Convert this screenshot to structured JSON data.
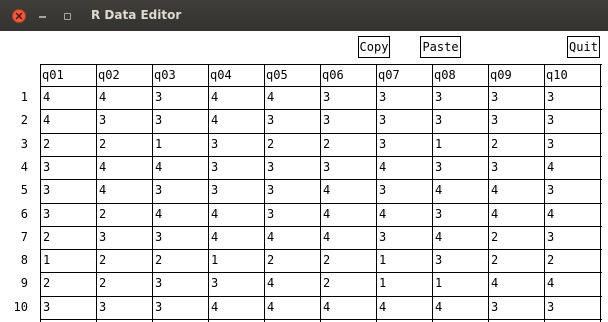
{
  "window": {
    "title": "R Data Editor"
  },
  "toolbar": {
    "copy_label": "Copy",
    "paste_label": "Paste",
    "quit_label": "Quit"
  },
  "table": {
    "columns": [
      "q01",
      "q02",
      "q03",
      "q04",
      "q05",
      "q06",
      "q07",
      "q08",
      "q09",
      "q10"
    ],
    "row_labels": [
      "1",
      "2",
      "3",
      "4",
      "5",
      "6",
      "7",
      "8",
      "9",
      "10"
    ],
    "rows": [
      [
        "4",
        "4",
        "3",
        "4",
        "4",
        "3",
        "3",
        "3",
        "3",
        "3"
      ],
      [
        "4",
        "3",
        "3",
        "4",
        "3",
        "3",
        "3",
        "3",
        "3",
        "3"
      ],
      [
        "2",
        "2",
        "1",
        "3",
        "2",
        "2",
        "3",
        "1",
        "2",
        "3"
      ],
      [
        "3",
        "4",
        "4",
        "3",
        "3",
        "3",
        "4",
        "3",
        "3",
        "4"
      ],
      [
        "3",
        "4",
        "3",
        "3",
        "3",
        "4",
        "3",
        "4",
        "4",
        "3"
      ],
      [
        "3",
        "2",
        "4",
        "4",
        "3",
        "4",
        "4",
        "3",
        "4",
        "4"
      ],
      [
        "2",
        "3",
        "3",
        "4",
        "4",
        "4",
        "3",
        "4",
        "2",
        "3"
      ],
      [
        "1",
        "2",
        "2",
        "1",
        "2",
        "2",
        "1",
        "3",
        "2",
        "2"
      ],
      [
        "2",
        "2",
        "3",
        "3",
        "4",
        "2",
        "1",
        "1",
        "4",
        "4"
      ],
      [
        "3",
        "3",
        "3",
        "4",
        "4",
        "4",
        "4",
        "4",
        "3",
        "3"
      ]
    ]
  },
  "colors": {
    "titlebar": "#3c3b37",
    "title_text": "#dfdbd2",
    "close_button": "#ef5a3c",
    "grid_lines": "#000000"
  },
  "icons": {
    "close": "close-icon",
    "minimize": "minimize-icon",
    "maximize": "maximize-icon"
  }
}
